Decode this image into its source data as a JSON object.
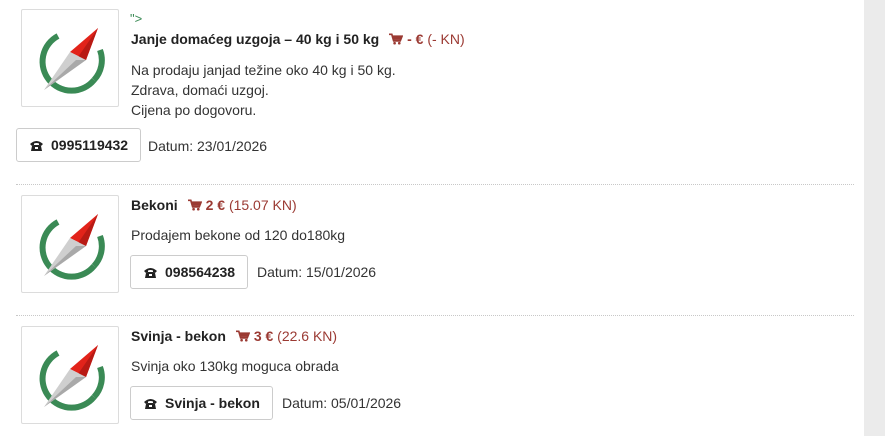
{
  "stray_text": "\">",
  "colors": {
    "price": "#9b3a33",
    "green": "#3a8a55",
    "red": "#e2231a"
  },
  "listings": [
    {
      "title": "Janje domaćeg uzgoja – 40 kg i 50 kg",
      "price_eur": "- €",
      "price_kn": "(- KN)",
      "description": [
        "Na prodaju janjad težine oko 40 kg i 50 kg.",
        "Zdrava, domaći uzgoj.",
        "Cijena po dogovoru."
      ],
      "phone": "0995119432",
      "date": "Datum: 23/01/2026",
      "thumb_icon": "compass-logo-icon"
    },
    {
      "title": "Bekoni",
      "price_eur": "2 €",
      "price_kn": "(15.07 KN)",
      "description": [
        "Prodajem bekone od 120 do180kg"
      ],
      "phone": "098564238",
      "date": "Datum: 15/01/2026",
      "thumb_icon": "compass-logo-icon"
    },
    {
      "title": "Svinja - bekon",
      "price_eur": "3 €",
      "price_kn": "(22.6 KN)",
      "description": [
        "Svinja oko 130kg moguca obrada"
      ],
      "phone": "Svinja - bekon",
      "date": "Datum: 05/01/2026",
      "thumb_icon": "compass-logo-icon"
    }
  ]
}
